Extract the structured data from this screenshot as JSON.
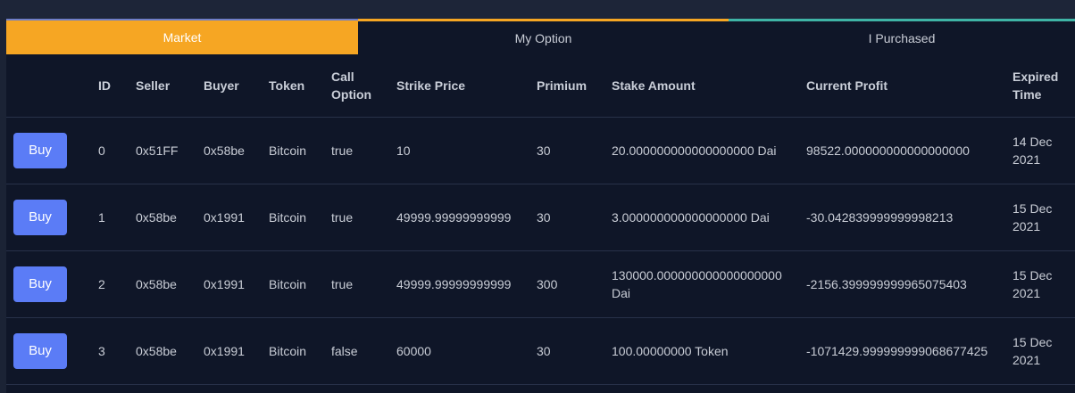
{
  "tabs": [
    {
      "label": "Market",
      "active": true
    },
    {
      "label": "My Option",
      "active": false
    },
    {
      "label": "I Purchased",
      "active": false
    }
  ],
  "table": {
    "headers": [
      "",
      "ID",
      "Seller",
      "Buyer",
      "Token",
      "Call Option",
      "Strike Price",
      "Primium",
      "Stake Amount",
      "Current Profit",
      "Expired Time"
    ],
    "buy_label": "Buy",
    "rows": [
      {
        "id": "0",
        "seller": "0x51FF",
        "buyer": "0x58be",
        "token": "Bitcoin",
        "call_option": "true",
        "strike_price": "10",
        "premium": "30",
        "stake_amount": "20.000000000000000000 Dai",
        "current_profit": "98522.000000000000000000",
        "profit_status": "positive",
        "expired_time": "14 Dec 2021"
      },
      {
        "id": "1",
        "seller": "0x58be",
        "buyer": "0x1991",
        "token": "Bitcoin",
        "call_option": "true",
        "strike_price": "49999.99999999999",
        "premium": "30",
        "stake_amount": "3.000000000000000000 Dai",
        "current_profit": "-30.042839999999998213",
        "profit_status": "negative",
        "expired_time": "15 Dec 2021"
      },
      {
        "id": "2",
        "seller": "0x58be",
        "buyer": "0x1991",
        "token": "Bitcoin",
        "call_option": "true",
        "strike_price": "49999.99999999999",
        "premium": "300",
        "stake_amount": "130000.000000000000000000 Dai",
        "current_profit": "-2156.399999999965075403",
        "profit_status": "negative",
        "expired_time": "15 Dec 2021"
      },
      {
        "id": "3",
        "seller": "0x58be",
        "buyer": "0x1991",
        "token": "Bitcoin",
        "call_option": "false",
        "strike_price": "60000",
        "premium": "30",
        "stake_amount": "100.00000000 Token",
        "current_profit": "-1071429.999999999068677425",
        "profit_status": "negative",
        "expired_time": "15 Dec 2021"
      }
    ]
  },
  "colors": {
    "accent": "#f6a623",
    "button": "#5b7cf6",
    "profit_positive": "#1f9d3a",
    "profit_negative": "#ef2929",
    "background": "#0f1628"
  }
}
